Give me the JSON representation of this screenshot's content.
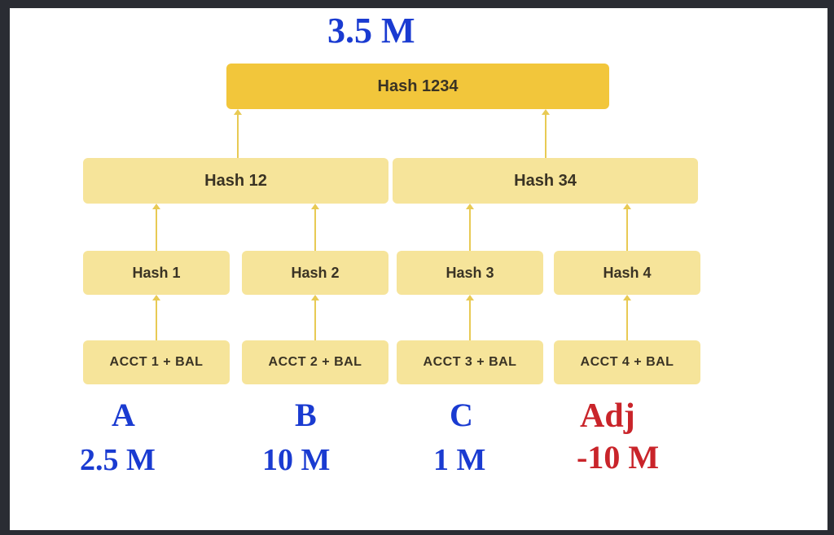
{
  "annotation_top": "3.5 M",
  "root": {
    "label": "Hash 1234"
  },
  "mids": [
    {
      "label": "Hash 12"
    },
    {
      "label": "Hash 34"
    }
  ],
  "leafs": [
    {
      "label": "Hash 1"
    },
    {
      "label": "Hash 2"
    },
    {
      "label": "Hash 3"
    },
    {
      "label": "Hash 4"
    }
  ],
  "accts": [
    {
      "label": "ACCT 1 + BAL"
    },
    {
      "label": "ACCT 2 + BAL"
    },
    {
      "label": "ACCT 3 + BAL"
    },
    {
      "label": "ACCT 4 + BAL"
    }
  ],
  "handwritten": [
    {
      "name": "A",
      "value": "2.5 M",
      "color": "blue"
    },
    {
      "name": "B",
      "value": "10 M",
      "color": "blue"
    },
    {
      "name": "C",
      "value": "1 M",
      "color": "blue"
    },
    {
      "name": "Adj",
      "value": "-10 M",
      "color": "red"
    }
  ]
}
